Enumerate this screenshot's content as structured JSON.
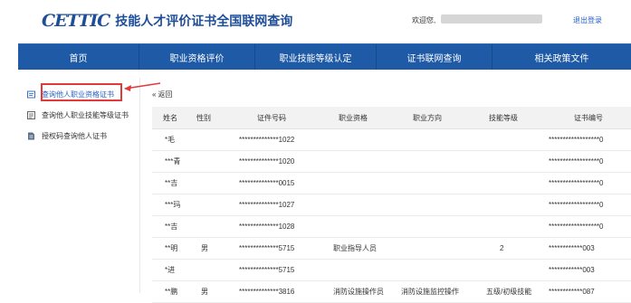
{
  "header": {
    "logo_text": "CETTIC",
    "site_title": "技能人才评价证书全国联网查询",
    "welcome": "欢迎您,",
    "logout": "退出登录"
  },
  "nav": [
    "首页",
    "职业资格评价",
    "职业技能等级认定",
    "证书联网查询",
    "相关政策文件"
  ],
  "sidebar": [
    {
      "label": "查询他人职业资格证书",
      "icon": "certificate-icon"
    },
    {
      "label": "查询他人职业技能等级证书",
      "icon": "level-certificate-icon"
    },
    {
      "label": "授权码查询他人证书",
      "icon": "auth-code-icon"
    }
  ],
  "back": "返回",
  "table": {
    "headers": [
      "姓名",
      "性别",
      "证件号码",
      "职业资格",
      "职业方向",
      "技能等级",
      "证书编号"
    ],
    "rows": [
      [
        "*毛",
        "",
        "**************1022",
        "",
        "",
        "",
        "******************0"
      ],
      [
        "***青",
        "",
        "**************1020",
        "",
        "",
        "",
        "******************0"
      ],
      [
        "**吉",
        "",
        "**************0015",
        "",
        "",
        "",
        "******************0"
      ],
      [
        "***玛",
        "",
        "**************1027",
        "",
        "",
        "",
        "******************0"
      ],
      [
        "**吉",
        "",
        "**************1028",
        "",
        "",
        "",
        "******************0"
      ],
      [
        "**明",
        "男",
        "**************5715",
        "职业指导人员",
        "",
        "2",
        "************003"
      ],
      [
        "*进",
        "",
        "**************5715",
        "",
        "",
        "",
        "************003"
      ],
      [
        "**鹏",
        "男",
        "**************3816",
        "消防设施操作员",
        "消防设施监控操作",
        "五级/初级技能",
        "************087"
      ]
    ]
  },
  "colors": {
    "brand": "#1f4e99",
    "nav_bg": "#1e5aa6",
    "highlight": "#e23a3a",
    "link": "#2a62c6"
  }
}
